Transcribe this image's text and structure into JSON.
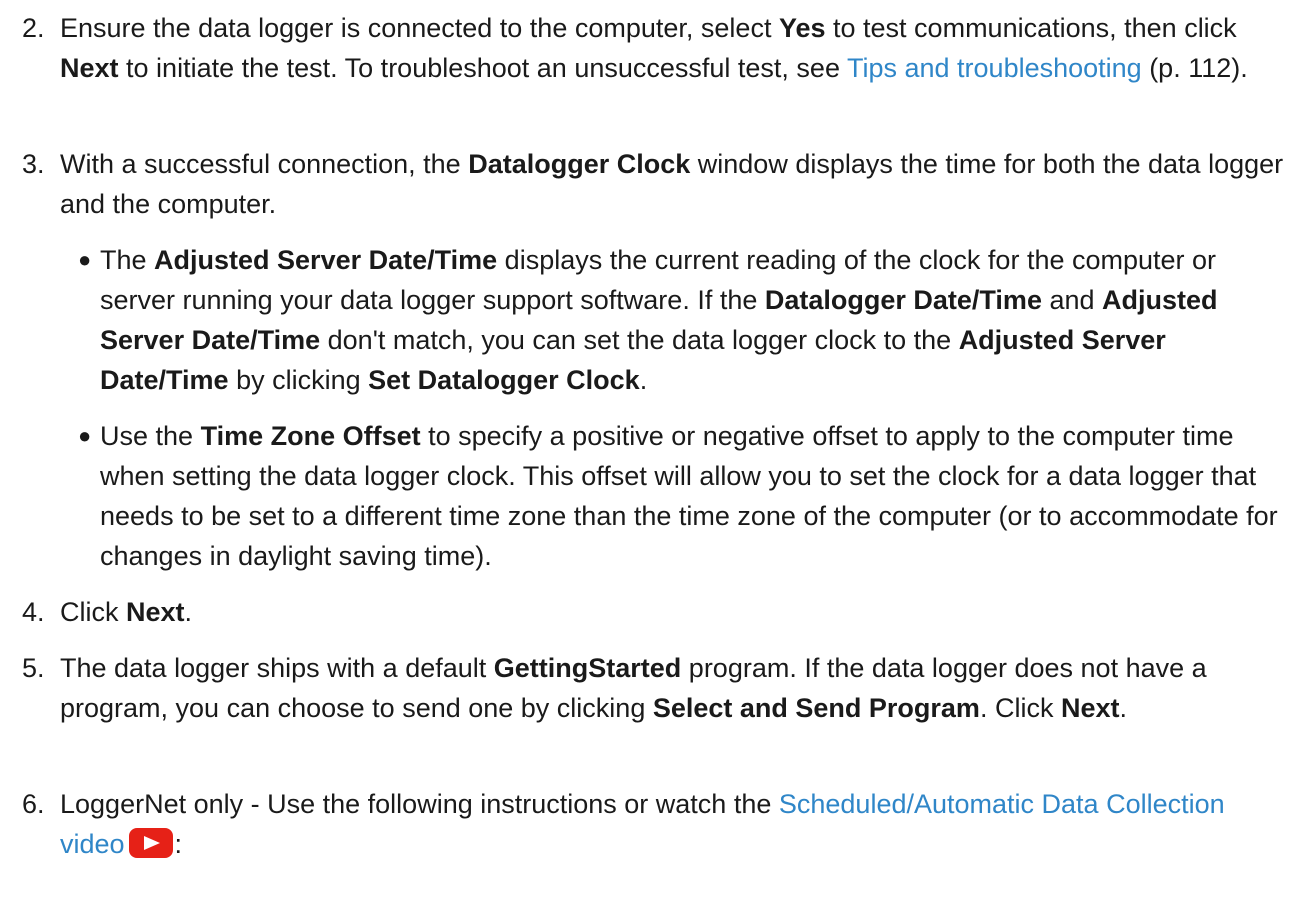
{
  "step2": {
    "num": "2.",
    "t1": "Ensure the data logger is connected to the computer, select ",
    "b1": "Yes",
    "t2": " to test communications, then click ",
    "b2": "Next",
    "t3": " to initiate the test. To troubleshoot an unsuccessful test, see ",
    "link": "Tips and troubleshooting",
    "t4": " (p. 112)."
  },
  "step3": {
    "num": "3.",
    "t1": "With a successful connection, the ",
    "b1": "Datalogger Clock",
    "t2": " window displays the time for both the data logger and the computer.",
    "bullet1": {
      "t1": "The ",
      "b1": "Adjusted Server Date/Time",
      "t2": " displays the current reading of the clock for the computer or server running your data logger support software. If the ",
      "b2": "Datalogger Date/Time",
      "t3": " and ",
      "b3": "Adjusted Server Date/Time",
      "t4": " don't match, you can set the data logger clock to the ",
      "b4": "Adjusted Server Date/Time",
      "t5": " by clicking ",
      "b5": "Set Datalogger Clock",
      "t6": "."
    },
    "bullet2": {
      "t1": "Use the ",
      "b1": "Time Zone Offset",
      "t2": " to specify a positive or negative offset to apply to the computer time when setting the data logger clock. This offset will allow you to set the clock for a data logger that needs to be set to a different time zone than the time zone of the computer (or to accommodate for changes in daylight saving time)."
    }
  },
  "step4": {
    "num": "4.",
    "t1": "Click ",
    "b1": "Next",
    "t2": "."
  },
  "step5": {
    "num": "5.",
    "t1": "The data logger ships with a default ",
    "b1": "GettingStarted",
    "t2": " program. If the data logger does not have a program, you can choose to send one by clicking ",
    "b2": "Select and Send Program",
    "t3": ". Click ",
    "b3": "Next",
    "t4": "."
  },
  "step6": {
    "num": "6.",
    "t1": "LoggerNet only - Use the following instructions or watch the ",
    "link": "Scheduled/Automatic Data Collection video",
    "t2": ":"
  },
  "icons": {
    "video": "youtube-play-icon"
  },
  "colors": {
    "link": "#2f86c8",
    "video": "#e62117"
  }
}
